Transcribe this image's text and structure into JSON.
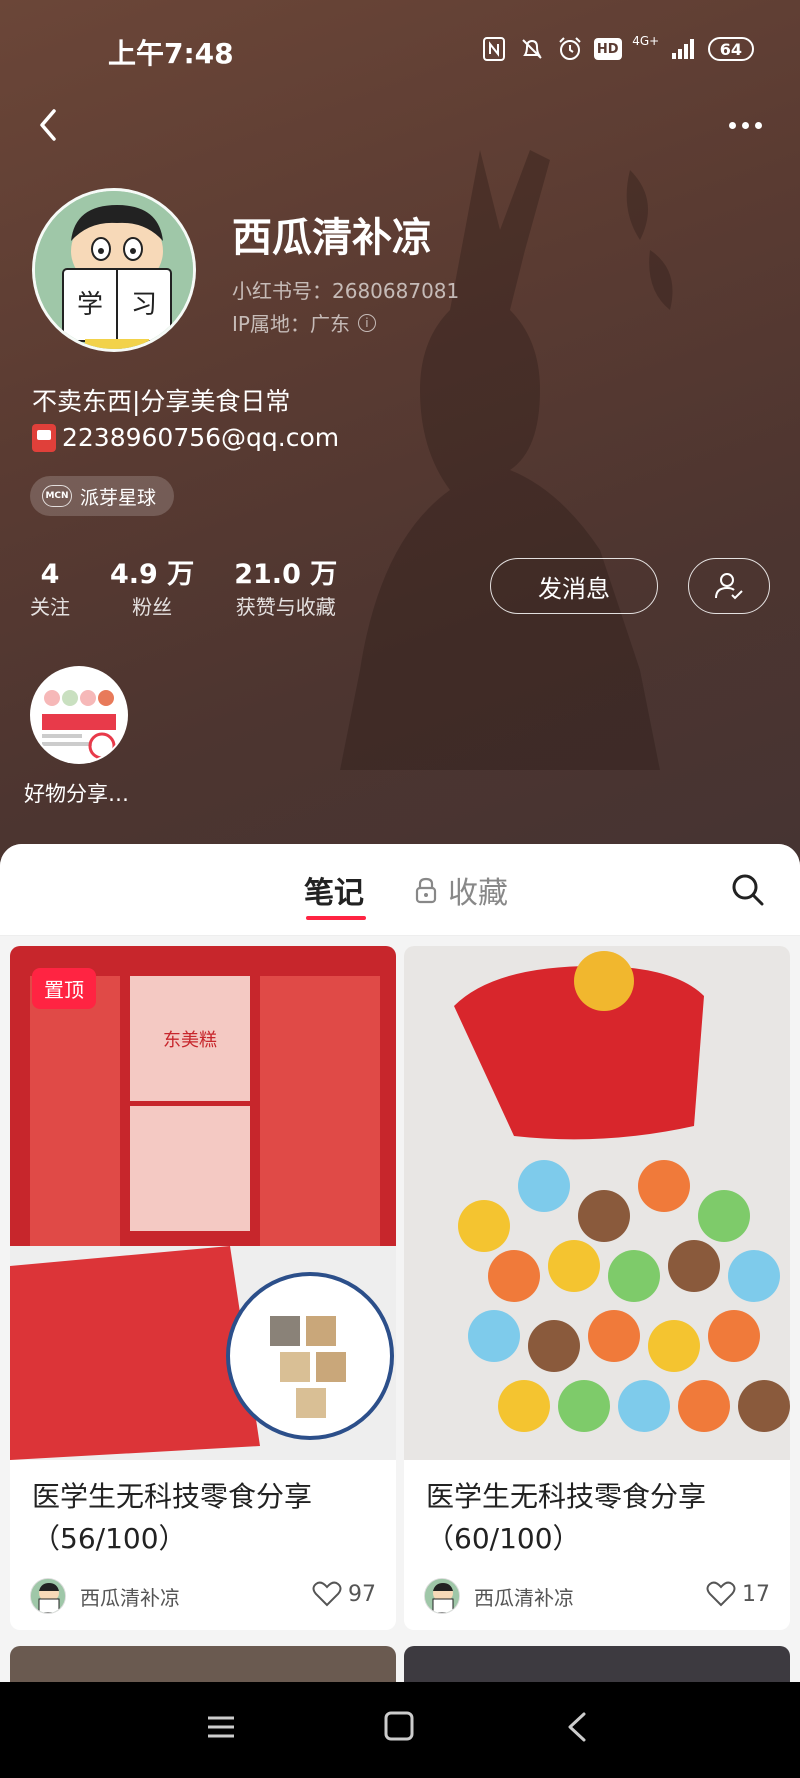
{
  "status_bar": {
    "time": "上午7:48",
    "network": "4G+",
    "hd": "HD",
    "battery": "64"
  },
  "profile": {
    "nickname": "西瓜清补凉",
    "xhs_id": "小红书号：2680687081",
    "ip_location": "IP属地：广东",
    "bio_line1": "不卖东西|分享美食日常",
    "bio_email": "2238960756@qq.com",
    "mcn_logo": "MCN",
    "mcn_tag": "派芽星球",
    "stats": [
      {
        "value": "4",
        "label": "关注"
      },
      {
        "value": "4.9 万",
        "label": "粉丝"
      },
      {
        "value": "21.0 万",
        "label": "获赞与收藏"
      }
    ],
    "message_button": "发消息",
    "collection_label": "好物分享…"
  },
  "tabs": {
    "notes": "笔记",
    "collections": "收藏"
  },
  "feed": [
    {
      "pinned_label": "置顶",
      "title": "医学生无科技零食分享（56/100）",
      "author": "西瓜清补凉",
      "likes": "97",
      "image_text": "东美糕"
    },
    {
      "title": "医学生无科技零食分享（60/100）",
      "author": "西瓜清补凉",
      "likes": "17"
    }
  ],
  "colors": {
    "accent": "#ff2442",
    "header_bg": "#5a3b32"
  }
}
